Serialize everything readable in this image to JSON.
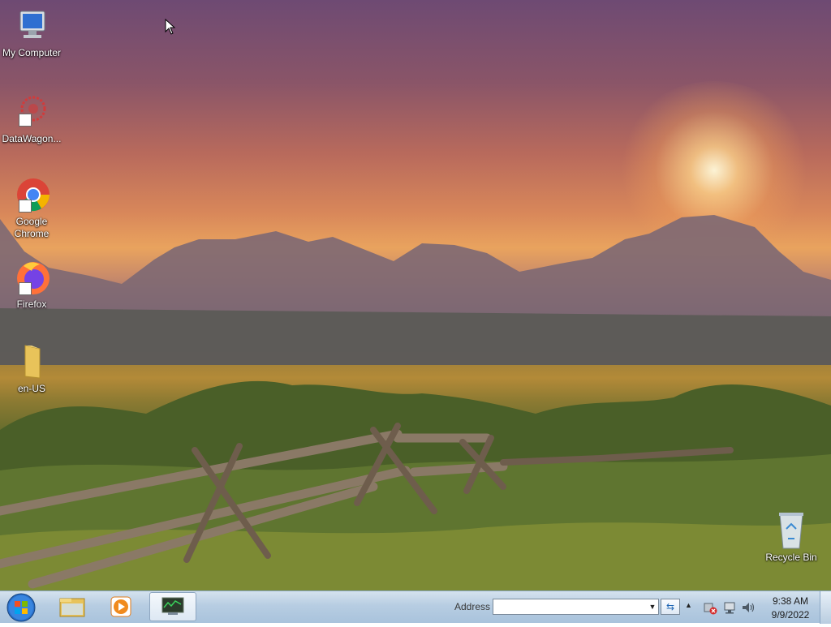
{
  "desktop": {
    "icons": [
      {
        "label": "My Computer",
        "icon": "computer-icon"
      },
      {
        "label": "DataWagon...",
        "icon": "datawagon-icon"
      },
      {
        "label": "Google Chrome",
        "icon": "chrome-icon"
      },
      {
        "label": "Firefox",
        "icon": "firefox-icon"
      },
      {
        "label": "en-US",
        "icon": "folder-icon"
      },
      {
        "label": "Recycle Bin",
        "icon": "recycle-bin-icon"
      }
    ]
  },
  "taskbar": {
    "start_icon": "windows-start-icon",
    "pinned": [
      {
        "name": "file-explorer",
        "icon": "folder-icon"
      },
      {
        "name": "media-player",
        "icon": "media-player-icon"
      },
      {
        "name": "task-manager",
        "icon": "monitor-app-icon",
        "active": true
      }
    ],
    "address": {
      "label": "Address",
      "value": ""
    },
    "tray": {
      "icons": [
        "show-hidden-icons-arrow",
        "network-error-icon",
        "network-icon",
        "volume-icon"
      ]
    },
    "clock": {
      "time": "9:38 AM",
      "date": "9/9/2022"
    }
  },
  "colors": {
    "taskbar_top": "#d5e2ee",
    "taskbar_bottom": "#a9c3dc",
    "sky_top": "#6e4a73",
    "sky_horizon": "#e9a35e"
  }
}
